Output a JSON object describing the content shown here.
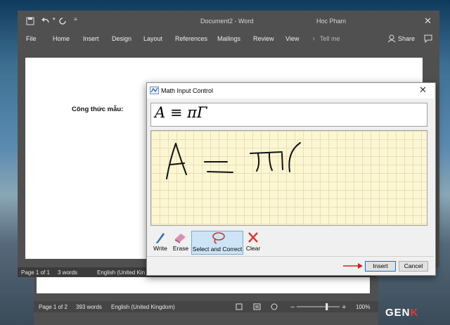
{
  "word": {
    "title": "Document2 - Word",
    "user": "Hoc Pham",
    "tabs": [
      "File",
      "Home",
      "Insert",
      "Design",
      "Layout",
      "References",
      "Mailings",
      "Review",
      "View"
    ],
    "tell_me": "Tell me",
    "share": "Share",
    "doc_text": "Công thức mẫu:",
    "status": {
      "page": "Page 1 of 1",
      "words": "3 words",
      "lang": "English (United Kin"
    }
  },
  "back_window": {
    "status": {
      "page": "Page 1 of 2",
      "words": "393 words",
      "lang": "English (United Kingdom)",
      "zoom": "100%"
    },
    "zoom_level": 0.7
  },
  "dialog": {
    "title": "Math Input Control",
    "preview": "A ≡ πΓ",
    "tools": [
      "Write",
      "Erase",
      "Select and Correct",
      "Clear"
    ],
    "selected_tool": "Select and Correct",
    "insert": "Insert",
    "cancel": "Cancel"
  },
  "watermark": {
    "prefix": "GEN",
    "suffix": "K"
  }
}
